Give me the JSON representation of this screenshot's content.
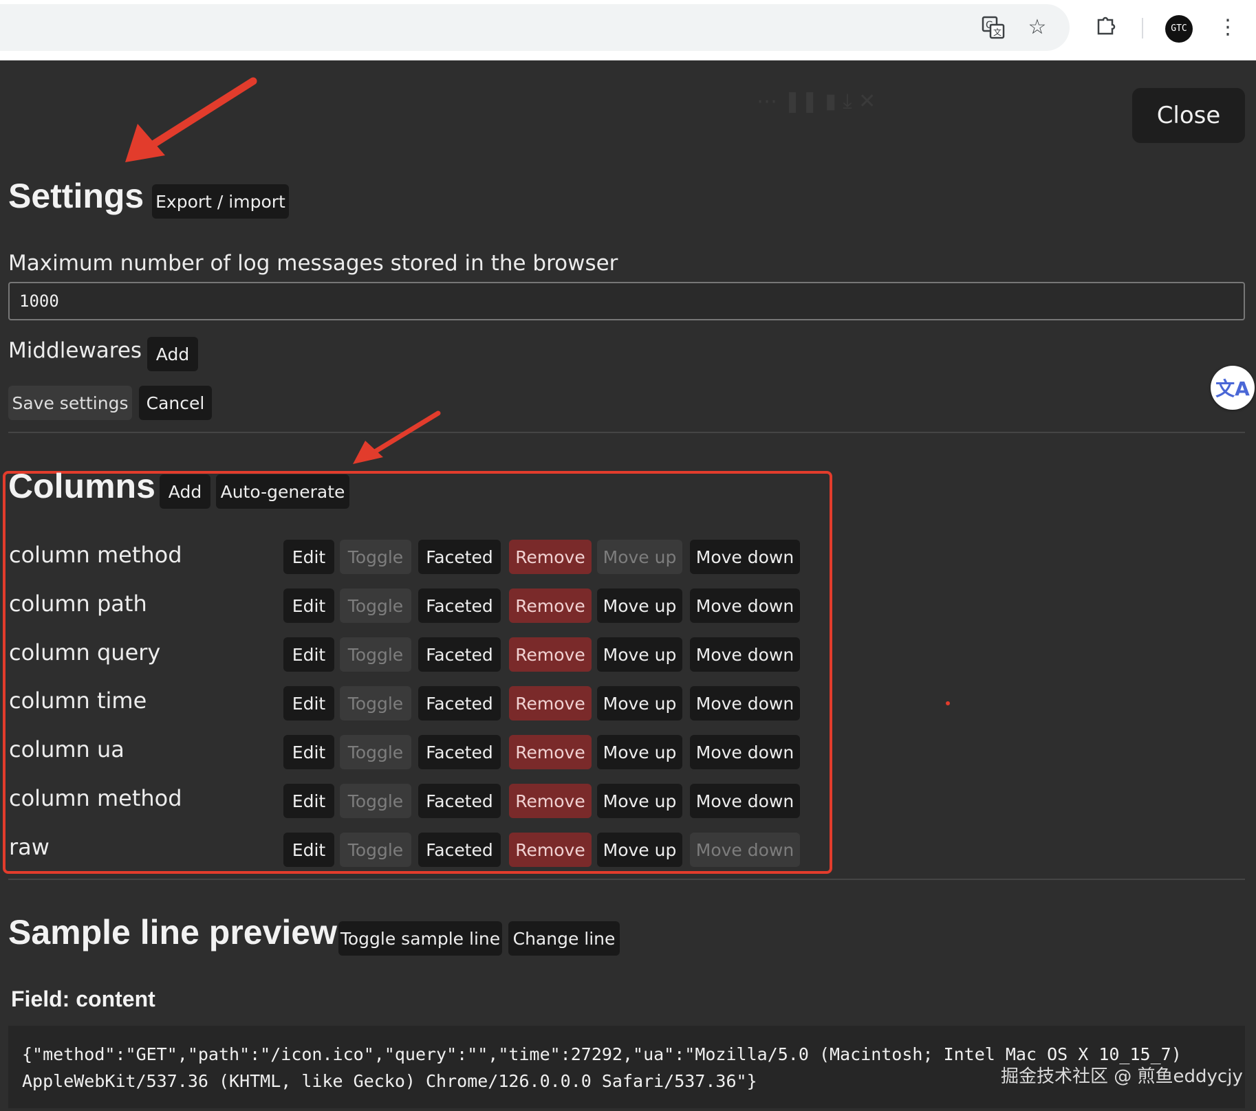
{
  "browser": {
    "icons": [
      "translate-icon",
      "star-icon",
      "extensions-icon",
      "avatar",
      "more-vert-icon"
    ],
    "avatar_text": "GTC"
  },
  "close_label": "Close",
  "settings": {
    "title": "Settings",
    "export_label": "Export / import",
    "max_label": "Maximum number of log messages stored in the browser",
    "max_value": "1000",
    "middlewares_label": "Middlewares",
    "add_label": "Add",
    "save_label": "Save settings",
    "cancel_label": "Cancel"
  },
  "columns": {
    "title": "Columns",
    "add_label": "Add",
    "autogen_label": "Auto-generate",
    "actions": {
      "edit": "Edit",
      "toggle": "Toggle",
      "faceted": "Faceted",
      "remove": "Remove",
      "move_up": "Move up",
      "move_down": "Move down"
    },
    "rows": [
      {
        "name": "column method"
      },
      {
        "name": "column path"
      },
      {
        "name": "column query"
      },
      {
        "name": "column time"
      },
      {
        "name": "column ua"
      },
      {
        "name": "column method"
      },
      {
        "name": "raw"
      }
    ]
  },
  "sample": {
    "title": "Sample line preview",
    "toggle_label": "Toggle sample line",
    "change_label": "Change line",
    "field_label": "Field: content",
    "content": "{\"method\":\"GET\",\"path\":\"/icon.ico\",\"query\":\"\",\"time\":27292,\"ua\":\"Mozilla/5.0 (Macintosh; Intel Mac OS X 10_15_7)\nAppleWebKit/537.36 (KHTML, like Gecko) Chrome/126.0.0.0 Safari/537.36\"}"
  },
  "watermark": "掘金技术社区 @ 煎鱼eddycjy",
  "translate_fab": "文A",
  "accent_color": "#e23c2c"
}
